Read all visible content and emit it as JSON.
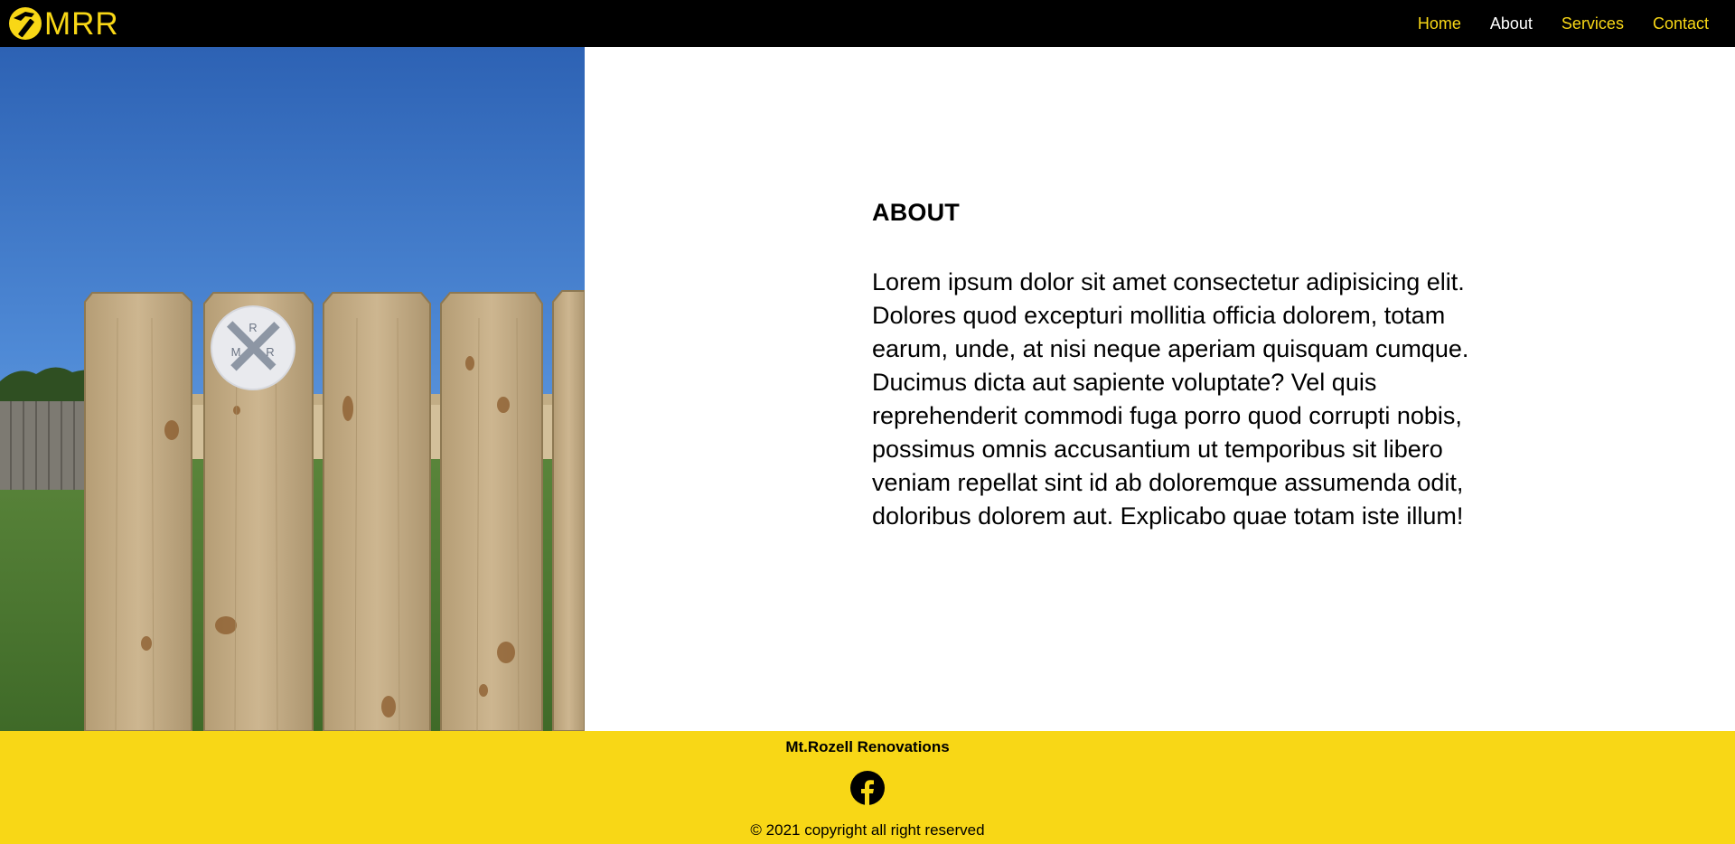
{
  "brand": {
    "logo_text": "MRR",
    "logo_icon": "hammer-circle-icon"
  },
  "nav": {
    "items": [
      {
        "label": "Home",
        "active": false
      },
      {
        "label": "About",
        "active": true
      },
      {
        "label": "Services",
        "active": false
      },
      {
        "label": "Contact",
        "active": false
      }
    ]
  },
  "hero": {
    "image": "wooden-fence-photo",
    "badge_letters": [
      "M",
      "R",
      "R"
    ]
  },
  "about": {
    "title": "ABOUT",
    "body": "Lorem ipsum dolor sit amet consectetur adipisicing elit. Dolores quod excepturi mollitia officia dolorem, totam earum, unde, at nisi neque aperiam quisquam cumque. Ducimus dicta aut sapiente voluptate? Vel quis reprehenderit commodi fuga porro quod corrupti nobis, possimus omnis accusantium ut temporibus sit libero veniam repellat sint id ab doloremque assumenda odit, doloribus dolorem aut. Explicabo quae totam iste illum!"
  },
  "footer": {
    "brand_name": "Mt.Rozell Renovations",
    "social_icon": "facebook-icon",
    "copyright": "© 2021 copyright all right reserved"
  },
  "colors": {
    "accent_yellow": "#f8d716",
    "nav_background": "#000000",
    "active_nav": "#ffffff"
  }
}
